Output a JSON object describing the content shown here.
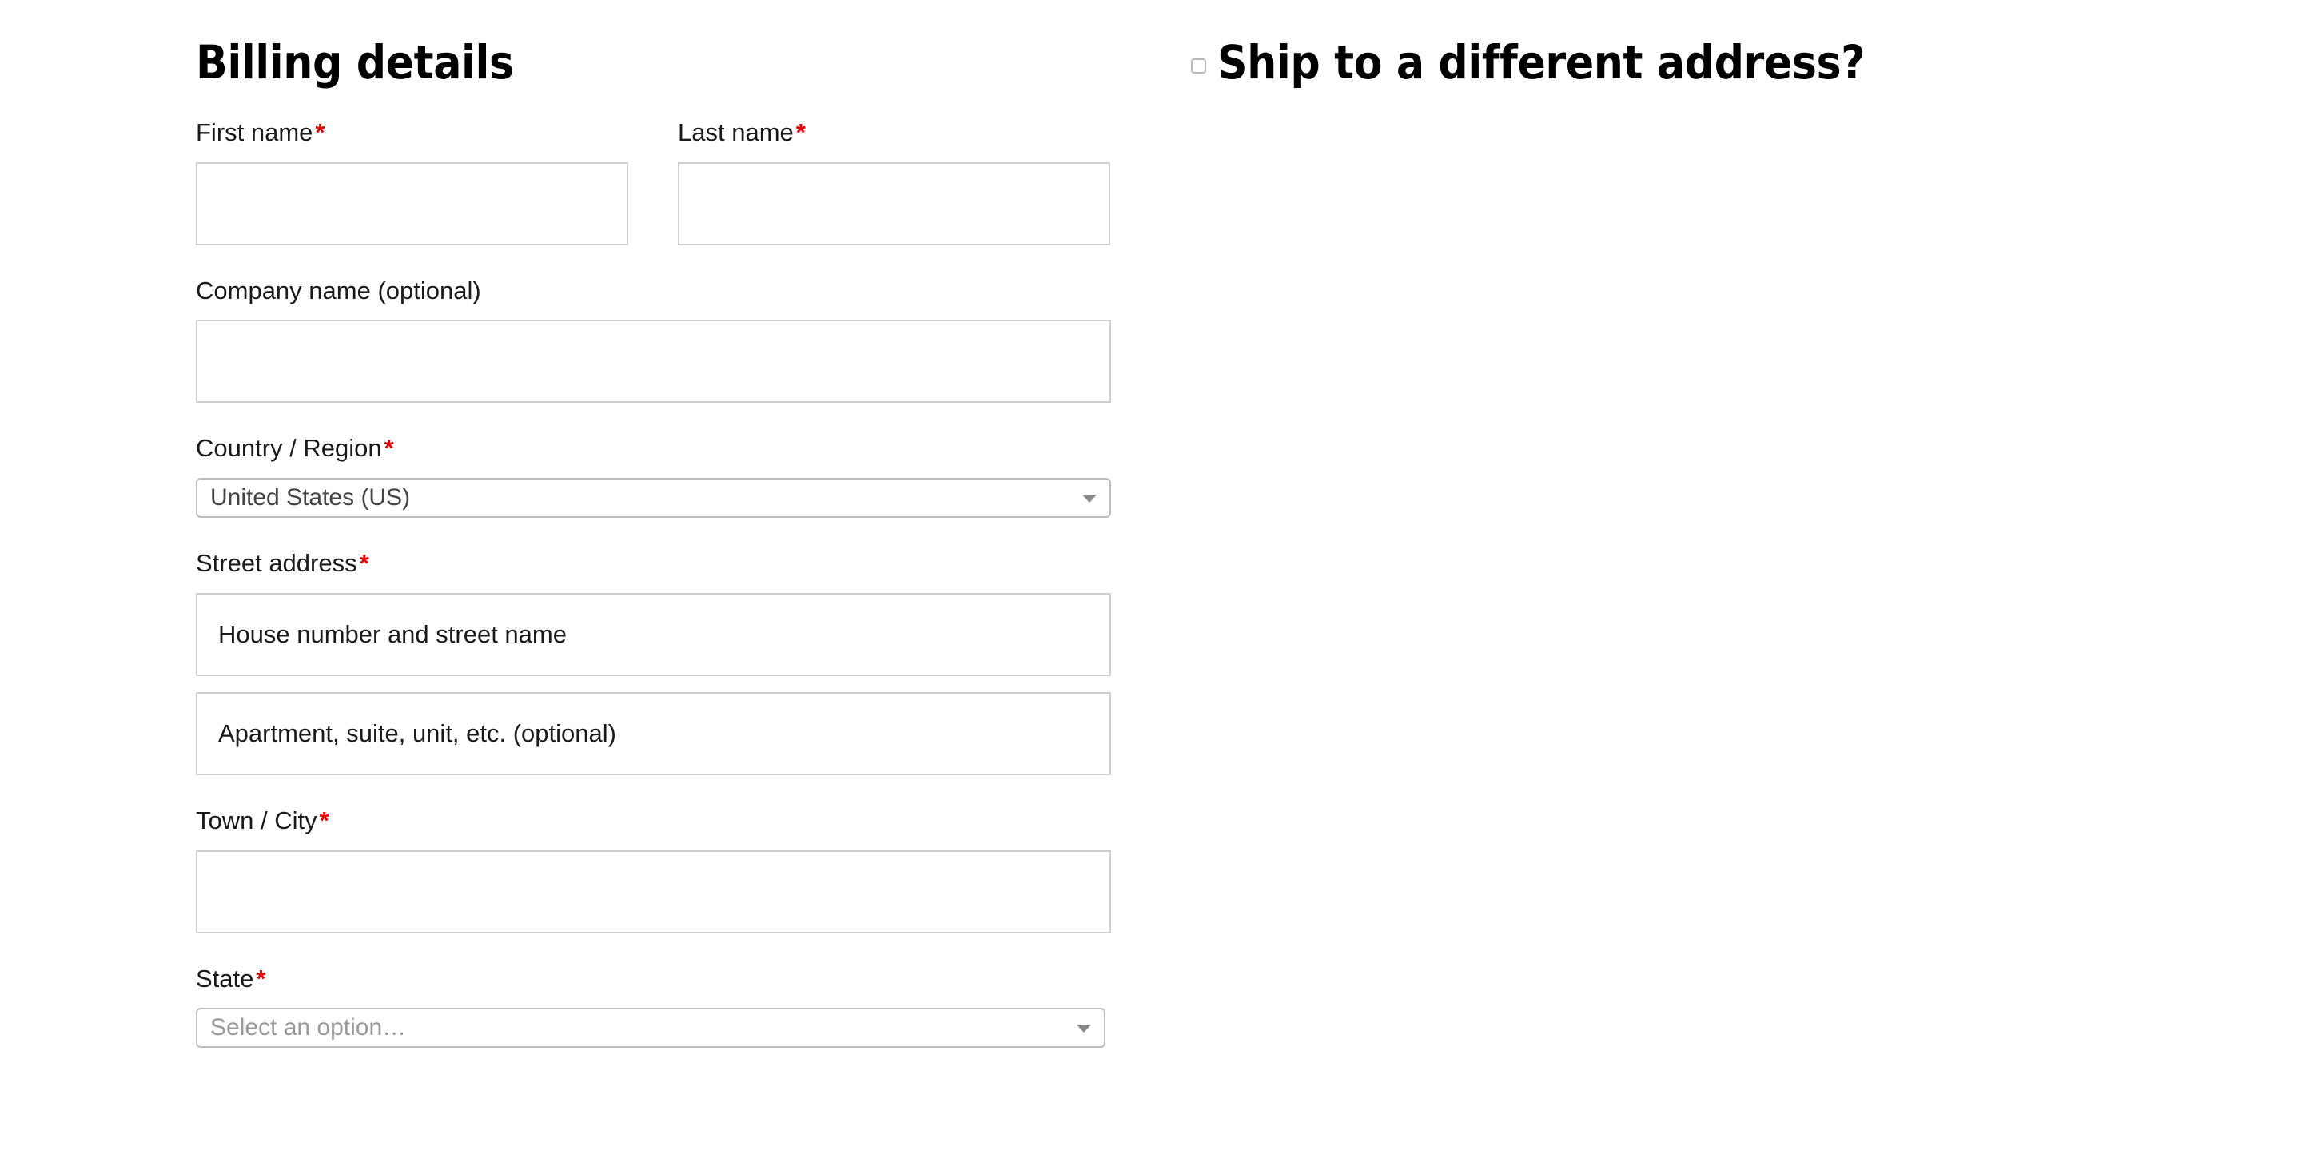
{
  "billing": {
    "title": "Billing details",
    "fields": {
      "first_name": {
        "label": "First name",
        "required_mark": "*",
        "value": "",
        "placeholder": ""
      },
      "last_name": {
        "label": "Last name",
        "required_mark": "*",
        "value": "",
        "placeholder": ""
      },
      "company": {
        "label": "Company name (optional)",
        "value": "",
        "placeholder": ""
      },
      "country": {
        "label": "Country / Region",
        "required_mark": "*",
        "selected": "United States (US)",
        "icon": "chevron-down-icon"
      },
      "street": {
        "label": "Street address",
        "required_mark": "*",
        "address_1_placeholder": "House number and street name",
        "address_1_value": "",
        "address_2_placeholder": "Apartment, suite, unit, etc. (optional)",
        "address_2_value": ""
      },
      "city": {
        "label": "Town / City",
        "required_mark": "*",
        "value": "",
        "placeholder": ""
      },
      "state": {
        "label": "State",
        "required_mark": "*",
        "selected": "Select an option…",
        "is_placeholder": true,
        "icon": "chevron-down-icon"
      }
    }
  },
  "shipping": {
    "toggle_label": "Ship to a different address?",
    "toggle_checked": false
  },
  "colors": {
    "required_asterisk": "#e60000",
    "input_border": "#cfcfcf",
    "select_border": "#bdbdbd",
    "text": "#1a1a1a",
    "select_text": "#444444",
    "placeholder_text": "#999999",
    "background": "#ffffff"
  }
}
